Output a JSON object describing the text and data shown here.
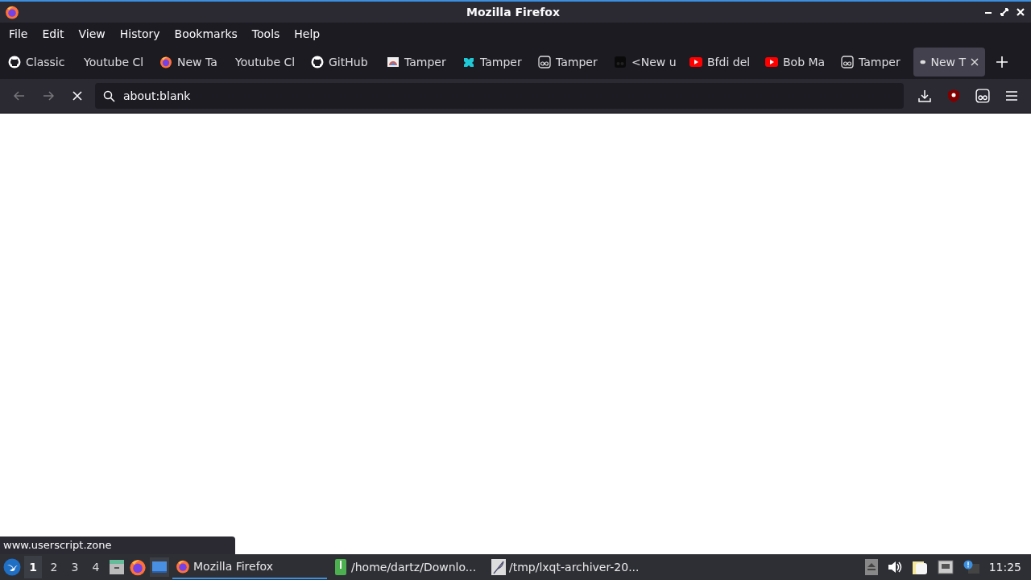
{
  "window": {
    "title": "Mozilla Firefox"
  },
  "menu": [
    "File",
    "Edit",
    "View",
    "History",
    "Bookmarks",
    "Tools",
    "Help"
  ],
  "tabs": [
    {
      "label": "Classic",
      "selected": false
    },
    {
      "label": "Youtube Cl",
      "selected": false
    },
    {
      "label": "New Ta",
      "selected": false
    },
    {
      "label": "Youtube Cl",
      "selected": false
    },
    {
      "label": "GitHub",
      "selected": false
    },
    {
      "label": "Tamper",
      "selected": false
    },
    {
      "label": "Tamper",
      "selected": false
    },
    {
      "label": "Tamper",
      "selected": false
    },
    {
      "label": "<New u",
      "selected": false
    },
    {
      "label": "Bfdi del",
      "selected": false
    },
    {
      "label": "Bob Ma",
      "selected": false
    },
    {
      "label": "Tamper",
      "selected": false
    },
    {
      "label": "New T",
      "selected": true
    }
  ],
  "address": {
    "value": "about:blank"
  },
  "status_text": "www.userscript.zone",
  "taskbar": {
    "desktops": [
      {
        "label": "1",
        "selected": true
      },
      {
        "label": "2",
        "selected": false
      },
      {
        "label": "3",
        "selected": false
      },
      {
        "label": "4",
        "selected": false
      }
    ],
    "tasks": [
      {
        "label": "Mozilla Firefox",
        "selected": true
      },
      {
        "label": "/home/dartz/Downlo...",
        "selected": false
      },
      {
        "label": "/tmp/lxqt-archiver-20...",
        "selected": false
      }
    ],
    "clock": "11:25"
  }
}
